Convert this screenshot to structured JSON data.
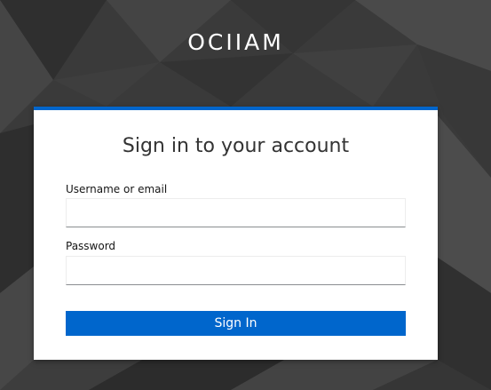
{
  "header": {
    "realm_title": "OCIIAM"
  },
  "login": {
    "title": "Sign in to your account",
    "username": {
      "label": "Username or email",
      "value": "",
      "placeholder": ""
    },
    "password": {
      "label": "Password",
      "value": "",
      "placeholder": ""
    },
    "submit_label": "Sign In"
  },
  "colors": {
    "background": "#3b3b3b",
    "accent": "#0066cc",
    "card": "#ffffff",
    "title_text": "#ffffff"
  }
}
